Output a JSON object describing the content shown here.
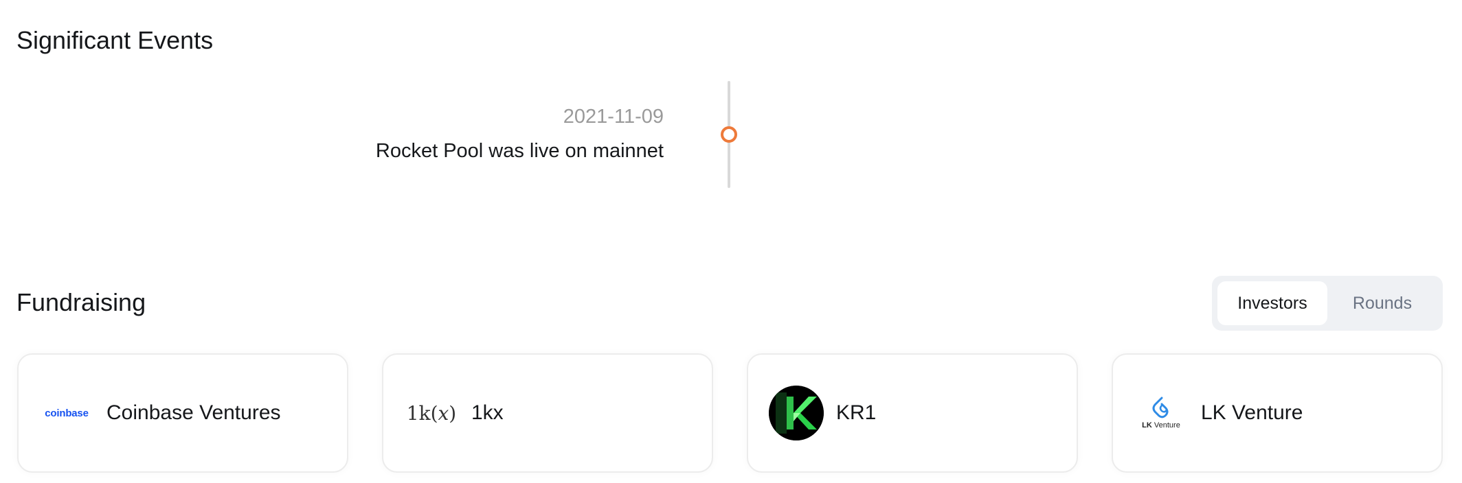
{
  "events": {
    "title": "Significant Events",
    "items": [
      {
        "date": "2021-11-09",
        "text": "Rocket Pool was live on mainnet"
      }
    ],
    "colors": {
      "dot": "#ee7a3a",
      "line": "#d9d9d9"
    }
  },
  "fundraising": {
    "title": "Fundraising",
    "tabs": [
      {
        "label": "Investors",
        "active": true
      },
      {
        "label": "Rounds",
        "active": false
      }
    ],
    "investors": [
      {
        "name": "Coinbase Ventures",
        "logo_text": "coinbase",
        "logo_icon": "coinbase-logo",
        "logo_color": "#1652f0"
      },
      {
        "name": "1kx",
        "logo_text": "1k(𝑥)",
        "logo_icon": "1kx-logo"
      },
      {
        "name": "KR1",
        "logo_icon": "kr1-logo",
        "logo_color": "#39e05a"
      },
      {
        "name": "LK Venture",
        "logo_text_bold": "LK",
        "logo_text_rest": " Venture",
        "logo_icon": "lk-venture-logo",
        "logo_color": "#2e8be6"
      }
    ]
  }
}
